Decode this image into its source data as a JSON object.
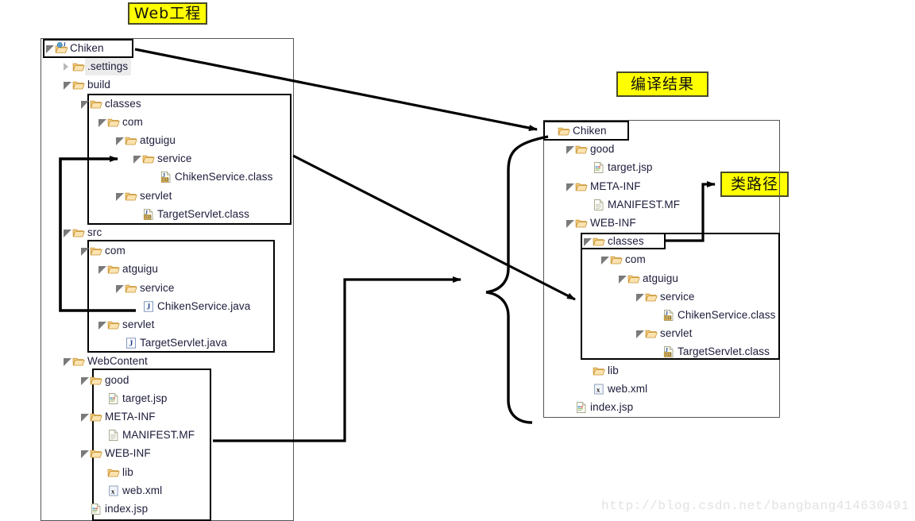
{
  "callouts": {
    "web_project": "Web工程",
    "compile_result": "编译结果",
    "classpath": "类路径"
  },
  "watermark": "http://blog.csdn.net/bangbang414630491",
  "left_tree": {
    "title": "Chiken",
    "nodes": [
      {
        "label": "Chiken",
        "icon": "java-project-icon",
        "depth": 0,
        "toggle": "open",
        "selected": false
      },
      {
        "label": ".settings",
        "icon": "folder-icon",
        "depth": 1,
        "toggle": "closed",
        "selected": true
      },
      {
        "label": "build",
        "icon": "folder-icon",
        "depth": 1,
        "toggle": "open",
        "selected": false
      },
      {
        "label": "classes",
        "icon": "folder-icon",
        "depth": 2,
        "toggle": "open",
        "selected": false
      },
      {
        "label": "com",
        "icon": "folder-icon",
        "depth": 3,
        "toggle": "open",
        "selected": false
      },
      {
        "label": "atguigu",
        "icon": "folder-icon",
        "depth": 4,
        "toggle": "open",
        "selected": false
      },
      {
        "label": "service",
        "icon": "folder-icon",
        "depth": 5,
        "toggle": "open",
        "selected": false
      },
      {
        "label": "ChikenService.class",
        "icon": "class-file-icon",
        "depth": 6,
        "toggle": "none",
        "selected": false
      },
      {
        "label": "servlet",
        "icon": "folder-icon",
        "depth": 4,
        "toggle": "open",
        "selected": false
      },
      {
        "label": "TargetServlet.class",
        "icon": "class-file-icon",
        "depth": 5,
        "toggle": "none",
        "selected": false
      },
      {
        "label": "src",
        "icon": "folder-icon",
        "depth": 1,
        "toggle": "open",
        "selected": false
      },
      {
        "label": "com",
        "icon": "folder-icon",
        "depth": 2,
        "toggle": "open",
        "selected": false
      },
      {
        "label": "atguigu",
        "icon": "folder-icon",
        "depth": 3,
        "toggle": "open",
        "selected": false
      },
      {
        "label": "service",
        "icon": "folder-icon",
        "depth": 4,
        "toggle": "open",
        "selected": false
      },
      {
        "label": "ChikenService.java",
        "icon": "java-file-icon",
        "depth": 5,
        "toggle": "none",
        "selected": false
      },
      {
        "label": "servlet",
        "icon": "folder-icon",
        "depth": 3,
        "toggle": "open",
        "selected": false
      },
      {
        "label": "TargetServlet.java",
        "icon": "java-file-icon",
        "depth": 4,
        "toggle": "none",
        "selected": false
      },
      {
        "label": "WebContent",
        "icon": "folder-icon",
        "depth": 1,
        "toggle": "open",
        "selected": false
      },
      {
        "label": "good",
        "icon": "folder-icon",
        "depth": 2,
        "toggle": "open",
        "selected": false
      },
      {
        "label": "target.jsp",
        "icon": "jsp-file-icon",
        "depth": 3,
        "toggle": "none",
        "selected": false
      },
      {
        "label": "META-INF",
        "icon": "folder-icon",
        "depth": 2,
        "toggle": "open",
        "selected": false
      },
      {
        "label": "MANIFEST.MF",
        "icon": "plain-file-icon",
        "depth": 3,
        "toggle": "none",
        "selected": false
      },
      {
        "label": "WEB-INF",
        "icon": "folder-icon",
        "depth": 2,
        "toggle": "open",
        "selected": false
      },
      {
        "label": "lib",
        "icon": "folder-icon",
        "depth": 3,
        "toggle": "none",
        "selected": false
      },
      {
        "label": "web.xml",
        "icon": "xml-file-icon",
        "depth": 3,
        "toggle": "none",
        "selected": false
      },
      {
        "label": "index.jsp",
        "icon": "jsp-file-icon",
        "depth": 2,
        "toggle": "none",
        "selected": false
      }
    ]
  },
  "right_tree": {
    "title": "Chiken",
    "nodes": [
      {
        "label": "Chiken",
        "icon": "folder-icon",
        "depth": 0,
        "toggle": "none",
        "selected": false
      },
      {
        "label": "good",
        "icon": "folder-icon",
        "depth": 1,
        "toggle": "open",
        "selected": false
      },
      {
        "label": "target.jsp",
        "icon": "jsp-file-icon",
        "depth": 2,
        "toggle": "none",
        "selected": false
      },
      {
        "label": "META-INF",
        "icon": "folder-icon",
        "depth": 1,
        "toggle": "open",
        "selected": false
      },
      {
        "label": "MANIFEST.MF",
        "icon": "plain-file-icon",
        "depth": 2,
        "toggle": "none",
        "selected": false
      },
      {
        "label": "WEB-INF",
        "icon": "folder-icon",
        "depth": 1,
        "toggle": "open",
        "selected": false
      },
      {
        "label": "classes",
        "icon": "folder-icon",
        "depth": 2,
        "toggle": "open",
        "selected": false
      },
      {
        "label": "com",
        "icon": "folder-icon",
        "depth": 3,
        "toggle": "open",
        "selected": false
      },
      {
        "label": "atguigu",
        "icon": "folder-icon",
        "depth": 4,
        "toggle": "open",
        "selected": false
      },
      {
        "label": "service",
        "icon": "folder-icon",
        "depth": 5,
        "toggle": "open",
        "selected": false
      },
      {
        "label": "ChikenService.class",
        "icon": "class-file-icon",
        "depth": 6,
        "toggle": "none",
        "selected": false
      },
      {
        "label": "servlet",
        "icon": "folder-icon",
        "depth": 5,
        "toggle": "open",
        "selected": false
      },
      {
        "label": "TargetServlet.class",
        "icon": "class-file-icon",
        "depth": 6,
        "toggle": "none",
        "selected": false
      },
      {
        "label": "lib",
        "icon": "folder-icon",
        "depth": 2,
        "toggle": "none",
        "selected": false
      },
      {
        "label": "web.xml",
        "icon": "xml-file-icon",
        "depth": 2,
        "toggle": "none",
        "selected": false
      },
      {
        "label": "index.jsp",
        "icon": "jsp-file-icon",
        "depth": 1,
        "toggle": "none",
        "selected": false
      }
    ]
  },
  "colors": {
    "highlight": "#ffff00",
    "folder": "#f0b64a",
    "text": "#1b1b3a",
    "stroke": "#000000"
  }
}
